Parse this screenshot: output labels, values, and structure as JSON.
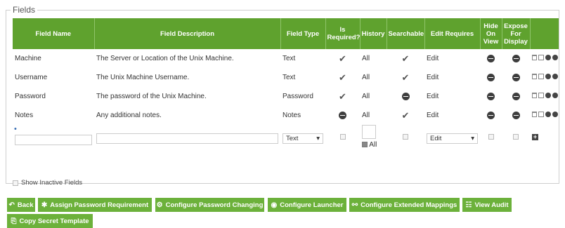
{
  "fields_legend": "Fields",
  "columns": [
    "Field Name",
    "Field Description",
    "Field Type",
    "Is Required?",
    "History",
    "Searchable",
    "Edit Requires",
    "Hide On View",
    "Expose For Display",
    ""
  ],
  "rows": [
    {
      "name": "Machine",
      "description": "The Server or Location of the Unix Machine.",
      "type": "Text",
      "required": "check",
      "history": "All",
      "searchable": "check",
      "edit": "Edit",
      "hide": "minus",
      "expose": "minus"
    },
    {
      "name": "Username",
      "description": "The Unix Machine Username.",
      "type": "Text",
      "required": "check",
      "history": "All",
      "searchable": "check",
      "edit": "Edit",
      "hide": "minus",
      "expose": "minus"
    },
    {
      "name": "Password",
      "description": "The password of the Unix Machine.",
      "type": "Password",
      "required": "check",
      "history": "All",
      "searchable": "minus",
      "edit": "Edit",
      "hide": "minus",
      "expose": "minus"
    },
    {
      "name": "Notes",
      "description": "Any additional notes.",
      "type": "Notes",
      "required": "minus",
      "history": "All",
      "searchable": "check",
      "edit": "Edit",
      "hide": "minus",
      "expose": "minus"
    }
  ],
  "new_row": {
    "name_value": "",
    "description_value": "",
    "type_selected": "Text",
    "history_label": "All",
    "edit_selected": "Edit"
  },
  "show_inactive_label": "Show Inactive Fields",
  "buttons": {
    "back": "Back",
    "assign_password_requirement": "Assign Password Requirement",
    "configure_password_changing": "Configure Password Changing",
    "configure_launcher": "Configure Launcher",
    "configure_extended_mappings": "Configure Extended Mappings",
    "view_audit": "View Audit",
    "copy_secret_template": "Copy Secret Template"
  },
  "colors": {
    "header_bg": "#5fa22e",
    "button_bg": "#6cb13b"
  },
  "icons": {
    "back": "reply-arrow-icon",
    "assign": "asterisk-icon",
    "configure_pc": "gear-icon",
    "launcher": "globe-icon",
    "mappings": "link-icon",
    "audit": "list-icon",
    "copy": "copy-icon"
  }
}
